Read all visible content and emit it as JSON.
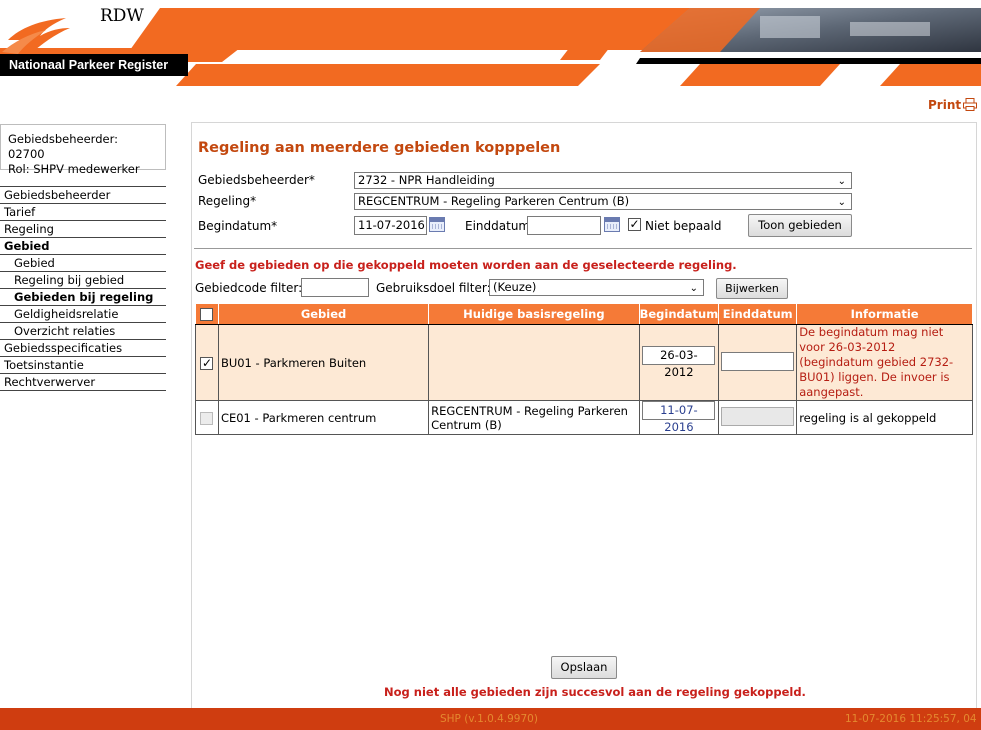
{
  "header": {
    "brand": "RDW",
    "app_title": "Nationaal Parkeer Register"
  },
  "toolbar": {
    "print_label": "Print"
  },
  "user_info": {
    "beheerder": "Gebiedsbeheerder: 02700",
    "rol": "Rol: SHPV medewerker"
  },
  "menu": {
    "items": [
      {
        "label": "Gebiedsbeheerder"
      },
      {
        "label": "Tarief"
      },
      {
        "label": "Regeling"
      },
      {
        "label": "Gebied"
      },
      {
        "label": "Gebied"
      },
      {
        "label": "Regeling bij gebied"
      },
      {
        "label": "Gebieden bij regeling"
      },
      {
        "label": "Geldigheidsrelatie"
      },
      {
        "label": "Overzicht relaties"
      },
      {
        "label": "Gebiedsspecificaties"
      },
      {
        "label": "Toetsinstantie"
      },
      {
        "label": "Rechtverwerver"
      }
    ]
  },
  "form": {
    "title": "Regeling aan meerdere gebieden kopppelen",
    "gebiedsbeheerder_label": "Gebiedsbeheerder*",
    "gebiedsbeheerder_value": "2732 - NPR Handleiding",
    "regeling_label": "Regeling*",
    "regeling_value": "REGCENTRUM - Regeling Parkeren Centrum (B)",
    "begindatum_label": "Begindatum*",
    "begindatum_value": "11-07-2016",
    "einddatum_label": "Einddatum",
    "einddatum_value": "",
    "niet_bepaald_label": "Niet bepaald",
    "niet_bepaald_checked": true,
    "toon_button": "Toon gebieden"
  },
  "instruction": "Geef de gebieden op die gekoppeld moeten worden aan de geselecteerde regeling.",
  "filters": {
    "gebiedcode_label": "Gebiedcode filter:",
    "gebiedcode_value": "",
    "gebruiksdoel_label": "Gebruiksdoel filter:",
    "gebruiksdoel_value": "(Keuze)",
    "update_button": "Bijwerken"
  },
  "table": {
    "headers": [
      "Gebied",
      "Huidige basisregeling",
      "Begindatum",
      "Einddatum",
      "Informatie"
    ],
    "rows": [
      {
        "checked": true,
        "gebied": "BU01 - Parkmeren Buiten",
        "basisregeling": "",
        "begindatum": "26-03-2012",
        "einddatum": "",
        "informatie": "De begindatum mag niet voor 26-03-2012 (begindatum gebied 2732-BU01) liggen. De invoer is aangepast."
      },
      {
        "checked": false,
        "gebied": "CE01 - Parkmeren centrum",
        "basisregeling": "REGCENTRUM - Regeling Parkeren Centrum (B)",
        "begindatum": "11-07-2016",
        "einddatum": "",
        "informatie": "regeling is al gekoppeld"
      }
    ]
  },
  "save_button": "Opslaan",
  "save_message": "Nog niet alle gebieden zijn succesvol aan de regeling gekoppeld.",
  "footer": {
    "version": "SHP (v.1.0.4.9970)",
    "timestamp": "11-07-2016 11:25:57, 04"
  },
  "colors": {
    "accent": "#c3480f",
    "header_orange": "#f57a37",
    "error_red": "#c8201b",
    "footer_bg": "#cf3d10",
    "selected_row": "#fde9d5"
  }
}
